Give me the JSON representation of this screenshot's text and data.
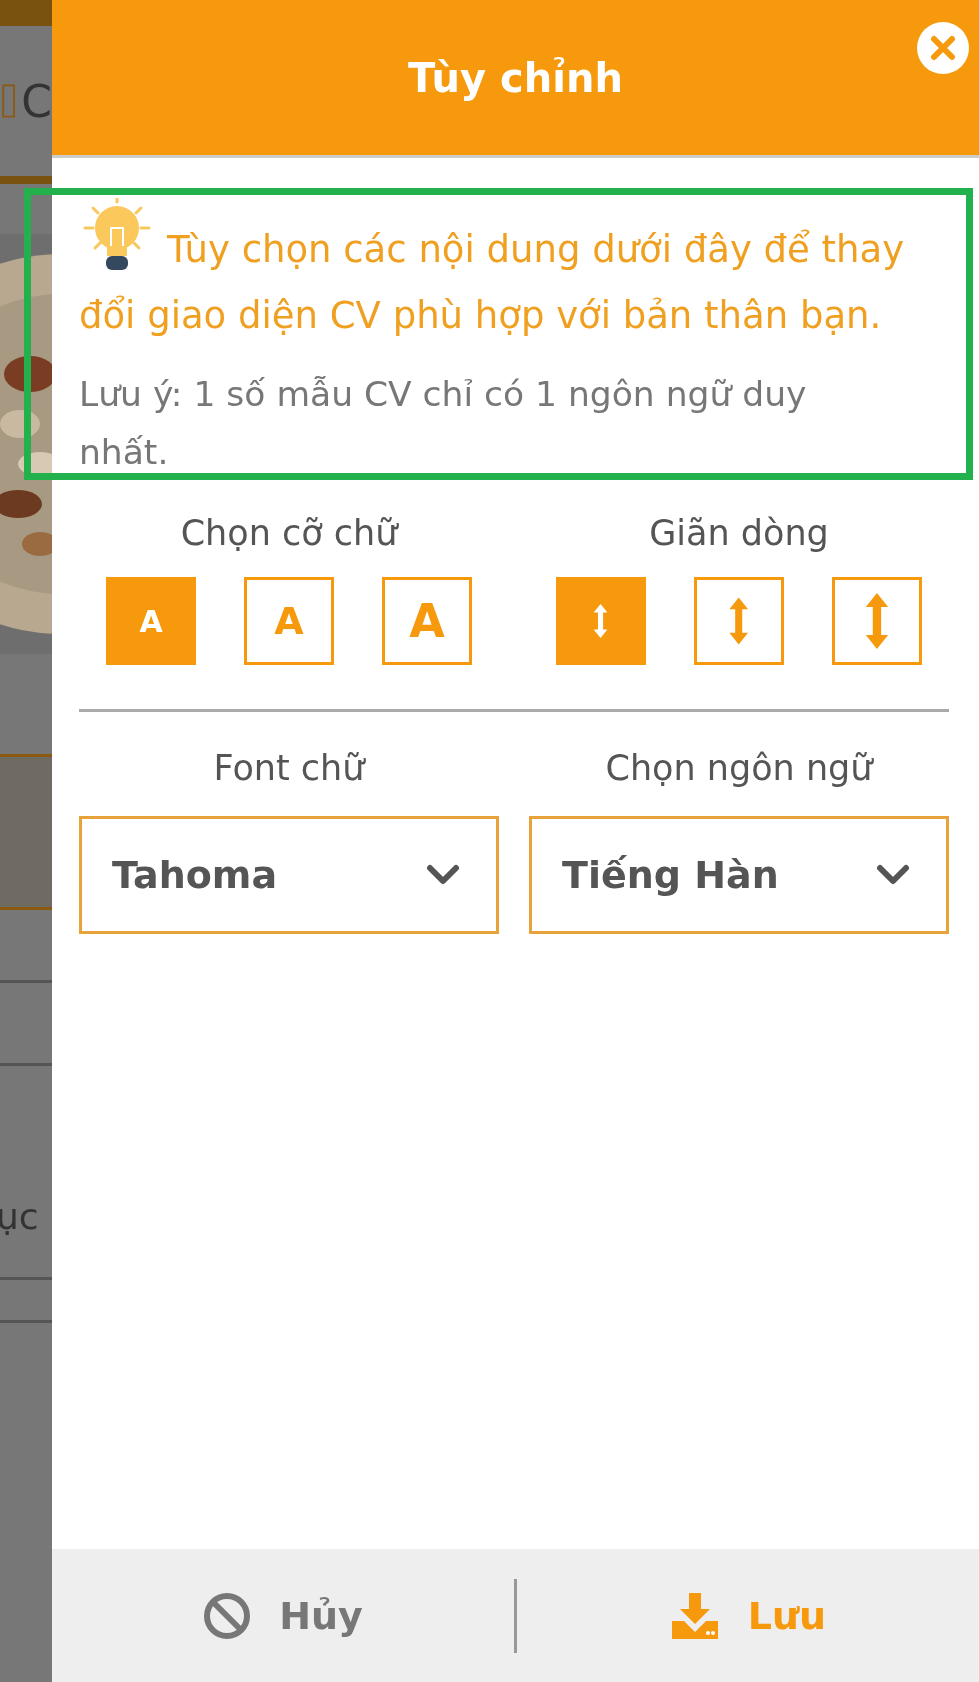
{
  "background_page": {
    "heading_fragment": "C",
    "label_fragment": "ục"
  },
  "dialog": {
    "title": "Tùy chỉnh",
    "tip": "Tùy chọn các nội dung dưới đây để thay đổi giao diện CV phù hợp với bản thân bạn.",
    "note": "Lưu ý: 1 số mẫu CV chỉ có 1 ngôn ngữ duy nhất.",
    "font_size": {
      "label": "Chọn cỡ chữ",
      "options": [
        {
          "text": "A",
          "selected": true
        },
        {
          "text": "A",
          "selected": false
        },
        {
          "text": "A",
          "selected": false
        }
      ]
    },
    "line_spacing": {
      "label": "Giãn dòng",
      "options": [
        {
          "selected": true
        },
        {
          "selected": false
        },
        {
          "selected": false
        }
      ]
    },
    "font": {
      "label": "Font chữ",
      "value": "Tahoma"
    },
    "language": {
      "label": "Chọn ngôn ngữ",
      "value": "Tiếng Hàn"
    },
    "footer": {
      "cancel": "Hủy",
      "save": "Lưu"
    }
  }
}
